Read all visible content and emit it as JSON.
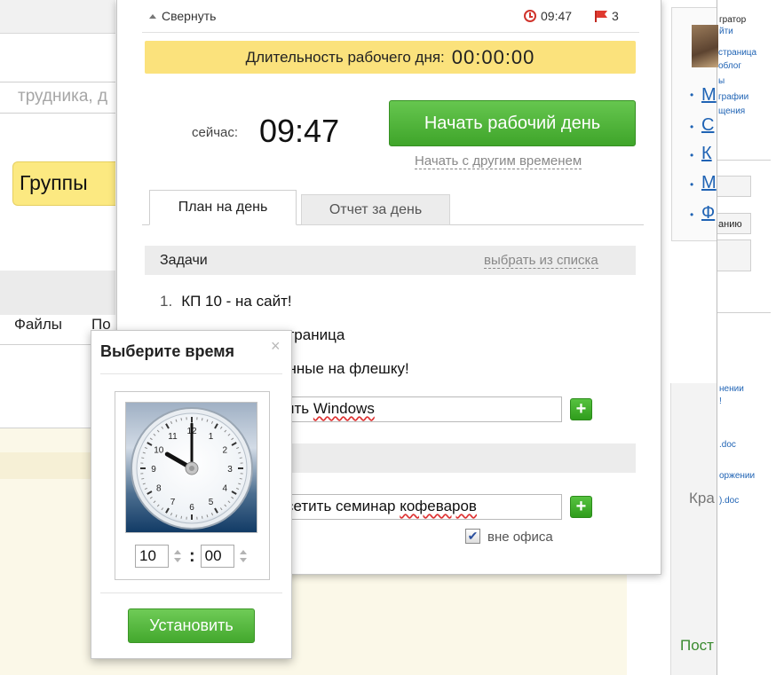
{
  "background": {
    "search_placeholder_partial": "трудника, д",
    "groups_button": "Группы",
    "nav_files": "Файлы",
    "nav_next": "По",
    "right_user_role": "гратор",
    "right_user_link": "йти",
    "right_menu_text": [
      "страница",
      "облог",
      "ы",
      "графии",
      "щения"
    ],
    "right_letters": [
      "М",
      "С",
      "К",
      "М",
      "Ф"
    ],
    "right_button_label": "анию",
    "right_file_links": [
      "нении",
      "!",
      ".doc",
      "оржении",
      ").doc"
    ],
    "right_kra": "Кра",
    "right_post": "Пост"
  },
  "popup": {
    "collapse_label": "Свернуть",
    "clock_time": "09:47",
    "flag_count": "3",
    "duration_label": "Длительность рабочего дня:",
    "duration_value": "00:00:00",
    "now_label": "сейчас:",
    "now_time": "09:47",
    "start_button": "Начать рабочий день",
    "start_other_link": "Начать с другим временем",
    "tabs": [
      {
        "label": "План на день",
        "active": true
      },
      {
        "label": "Отчет за день",
        "active": false
      }
    ],
    "tasks": {
      "title": "Задачи",
      "pick_link": "выбрать из списка",
      "items": [
        {
          "num": "1.",
          "text": "КП 10 - на сайт!"
        },
        {
          "num": "",
          "text": "страница"
        },
        {
          "num": "",
          "text": "анные на флешку!"
        }
      ],
      "new_task_value_prefix": "ить ",
      "new_task_value_word": "Windows"
    },
    "events": {
      "new_event_value_prefix": "сетить семинар ",
      "new_event_value_word": "кофеваров",
      "out_of_office_label": "вне офиса",
      "out_of_office_checked": true
    }
  },
  "time_picker": {
    "title": "Выберите время",
    "close_glyph": "×",
    "hours": "10",
    "minutes": "00",
    "colon": ":",
    "set_button": "Установить",
    "clock_numbers": [
      "12",
      "1",
      "2",
      "3",
      "4",
      "5",
      "6",
      "7",
      "8",
      "9",
      "10",
      "11"
    ],
    "clock_hour": 10,
    "clock_minute": 0
  },
  "colors": {
    "accent_green": "#43a82d",
    "duration_yellow": "#fbe27c",
    "flag_red": "#e0392f",
    "link_blue": "#1f63b4"
  },
  "icons": {
    "collapse": "chevron-up-icon",
    "clock": "clock-icon",
    "flag": "flag-icon",
    "add": "plus-icon",
    "close": "close-icon",
    "check": "checkmark-icon"
  }
}
